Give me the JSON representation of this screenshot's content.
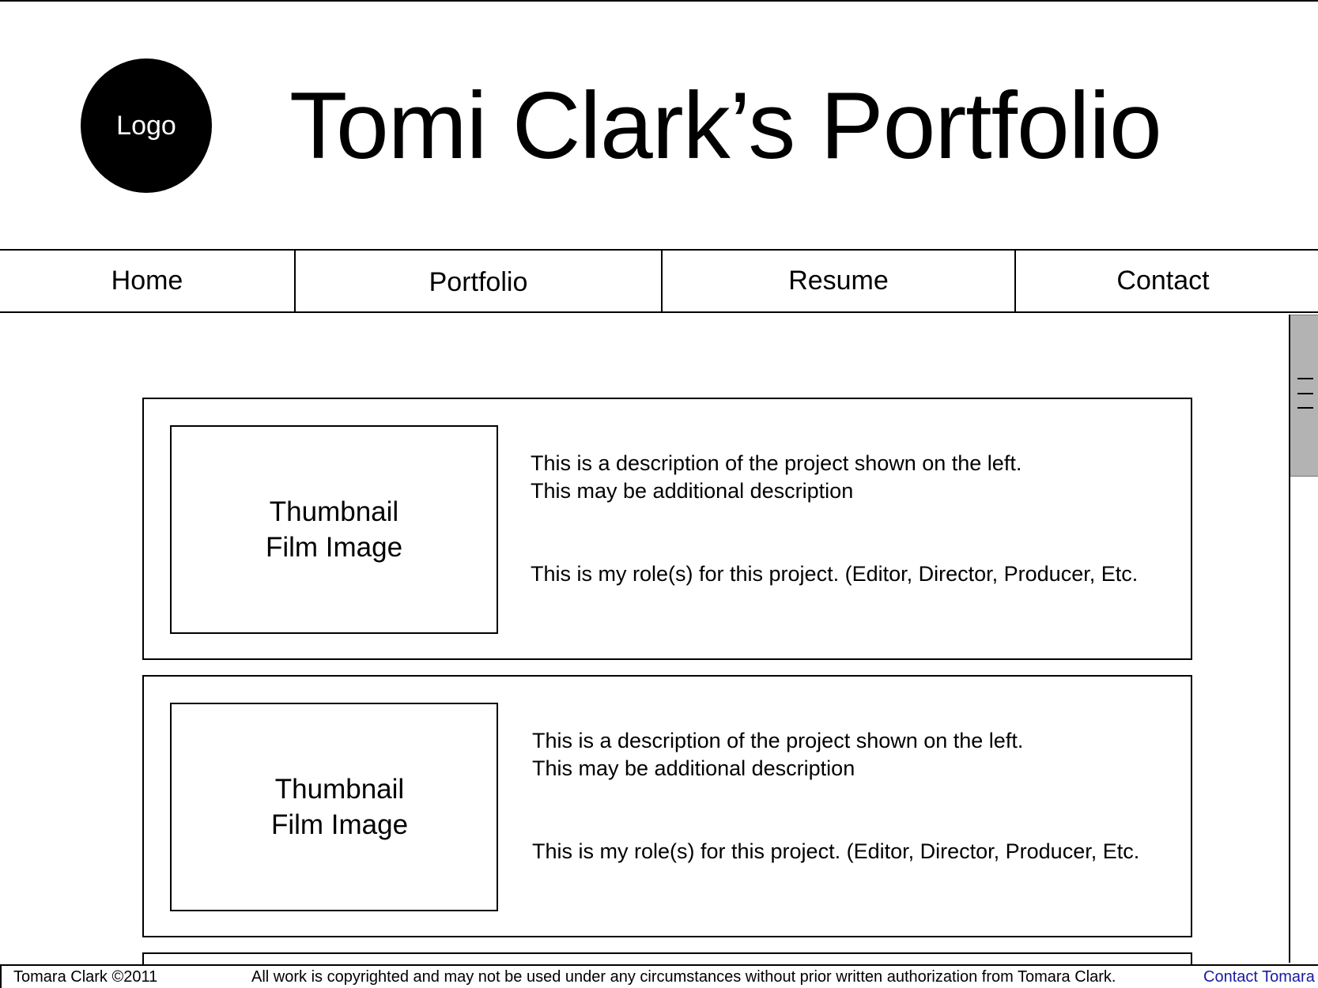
{
  "header": {
    "logo_text": "Logo",
    "title": "Tomi Clark’s Portfolio"
  },
  "nav": {
    "items": [
      {
        "label": "Home"
      },
      {
        "label": "Portfolio"
      },
      {
        "label": "Resume"
      },
      {
        "label": "Contact"
      }
    ]
  },
  "projects": [
    {
      "thumbnail_line1": "Thumbnail",
      "thumbnail_line2": "Film Image",
      "description_line1": "This is a description of the project shown on the left.",
      "description_line2": "This may be additional description",
      "role": "This is my role(s) for this project. (Editor, Director, Producer, Etc."
    },
    {
      "thumbnail_line1": "Thumbnail",
      "thumbnail_line2": "Film Image",
      "description_line1": "This is a description of the project shown on the left.",
      "description_line2": "This may be additional description",
      "role": "This is my role(s) for this project. (Editor, Director, Producer, Etc."
    }
  ],
  "footer": {
    "copyright": "Tomara Clark ©2011",
    "notice": "All work is copyrighted and may not be used under any circumstances without prior written authorization from Tomara Clark.",
    "contact_link": "Contact Tomara"
  },
  "colors": {
    "link": "#1a1aa6",
    "scrollbar_thumb": "#b3b3b3"
  }
}
